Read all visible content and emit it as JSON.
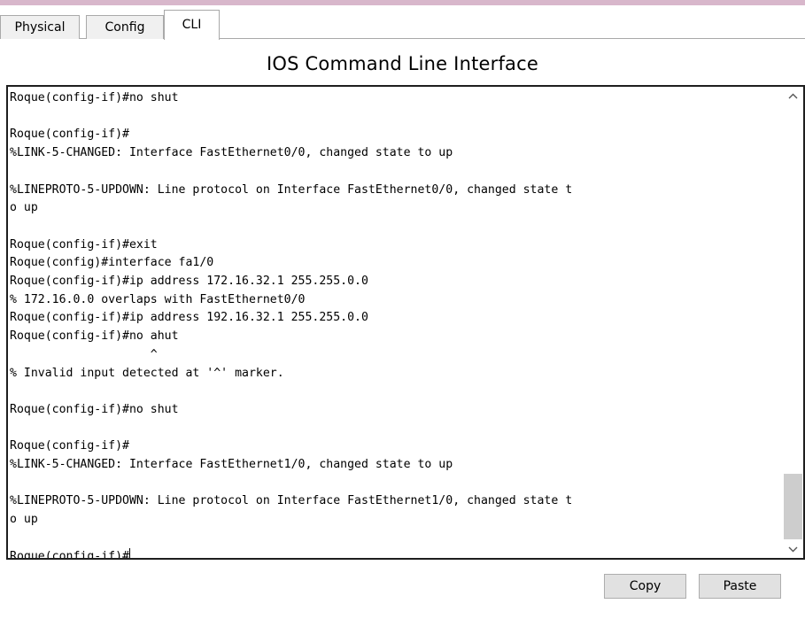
{
  "tabs": [
    {
      "label": "Physical"
    },
    {
      "label": "Config"
    },
    {
      "label": "CLI"
    }
  ],
  "title": "IOS Command Line Interface",
  "console": {
    "lines": [
      "Roque(config-if)#no shut",
      "",
      "Roque(config-if)#",
      "%LINK-5-CHANGED: Interface FastEthernet0/0, changed state to up",
      "",
      "%LINEPROTO-5-UPDOWN: Line protocol on Interface FastEthernet0/0, changed state t",
      "o up",
      "",
      "Roque(config-if)#exit",
      "Roque(config)#interface fa1/0",
      "Roque(config-if)#ip address 172.16.32.1 255.255.0.0",
      "% 172.16.0.0 overlaps with FastEthernet0/0",
      "Roque(config-if)#ip address 192.16.32.1 255.255.0.0",
      "Roque(config-if)#no ahut",
      "                    ^",
      "% Invalid input detected at '^' marker.",
      "",
      "Roque(config-if)#no shut",
      "",
      "Roque(config-if)#",
      "%LINK-5-CHANGED: Interface FastEthernet1/0, changed state to up",
      "",
      "%LINEPROTO-5-UPDOWN: Line protocol on Interface FastEthernet1/0, changed state t",
      "o up",
      ""
    ],
    "prompt": "Roque(config-if)#"
  },
  "buttons": {
    "copy": "Copy",
    "paste": "Paste"
  },
  "icons": {
    "scroll_up": "chevron-up-icon",
    "scroll_down": "chevron-down-icon"
  },
  "colors": {
    "accent_strip": "#d8b7cb",
    "scroll_thumb": "#cdcdcd",
    "button_bg": "#e1e1e1"
  }
}
